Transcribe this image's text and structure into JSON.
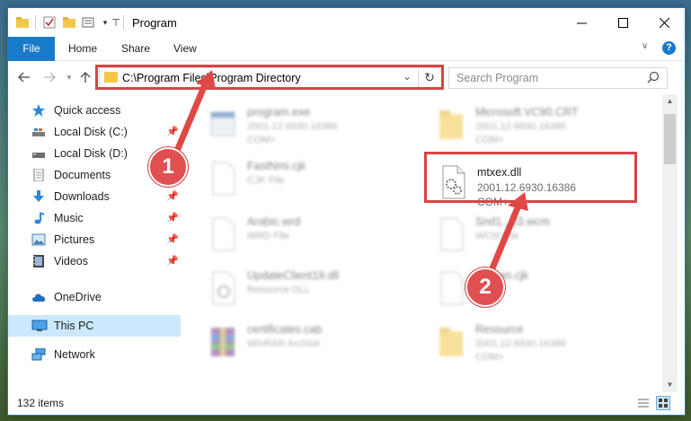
{
  "window": {
    "title": "Program"
  },
  "ribbon": {
    "tabs": [
      "File",
      "Home",
      "Share",
      "View"
    ],
    "help_label": "?"
  },
  "address": {
    "path": "C:\\Program Files\\Program Directory"
  },
  "search": {
    "placeholder": "Search Program"
  },
  "sidebar": {
    "items": [
      {
        "label": "Quick access",
        "icon": "star-icon",
        "pinned": false
      },
      {
        "label": "Local Disk (C:)",
        "icon": "drive-icon",
        "pinned": true
      },
      {
        "label": "Local Disk (D:)",
        "icon": "drive-icon",
        "pinned": true
      },
      {
        "label": "Documents",
        "icon": "documents-icon",
        "pinned": true
      },
      {
        "label": "Downloads",
        "icon": "download-icon",
        "pinned": true
      },
      {
        "label": "Music",
        "icon": "music-icon",
        "pinned": true
      },
      {
        "label": "Pictures",
        "icon": "pictures-icon",
        "pinned": true
      },
      {
        "label": "Videos",
        "icon": "videos-icon",
        "pinned": true
      },
      {
        "label": "OneDrive",
        "icon": "cloud-icon",
        "pinned": false
      },
      {
        "label": "This PC",
        "icon": "computer-icon",
        "pinned": false,
        "selected": true
      },
      {
        "label": "Network",
        "icon": "network-icon",
        "pinned": false
      }
    ]
  },
  "files": {
    "left": [
      {
        "name": "program.exe",
        "line1": "2001.12.6930.16386",
        "line2": "COM+"
      },
      {
        "name": "FastNmi.cjk",
        "line1": "CJK File",
        "line2": ""
      },
      {
        "name": "Arabic.wrd",
        "line1": "WRD File",
        "line2": ""
      },
      {
        "name": "UpdateClient19.dll",
        "line1": "Resource DLL",
        "line2": ""
      },
      {
        "name": "certificates.cab",
        "line1": "WinRAR Archive",
        "line2": ""
      }
    ],
    "right": [
      {
        "name": "Microsoft.VC90.CRT",
        "line1": "2001.12.6930.16386",
        "line2": "COM+"
      },
      {
        "name": "Snd1...03.wcm",
        "line1": "WCM File",
        "line2": ""
      },
      {
        "name": "Korean.cjk",
        "line1": "",
        "line2": ""
      },
      {
        "name": "Resource",
        "line1": "2001.12.6930.16386",
        "line2": "COM+"
      }
    ],
    "focused": {
      "name": "mtxex.dll",
      "line1": "2001.12.6930.16386",
      "line2": "COM+"
    }
  },
  "status": {
    "item_count": "132 items"
  },
  "markers": {
    "step1": "1",
    "step2": "2"
  },
  "colors": {
    "accent": "#1979ca",
    "highlight": "#d64545",
    "folder": "#f3c84a"
  }
}
